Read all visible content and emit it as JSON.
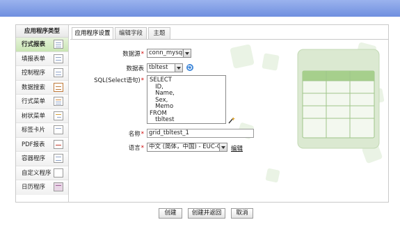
{
  "sidebar": {
    "title": "应用程序类型",
    "items": [
      {
        "label": "行式报表",
        "icon": "grid-report-icon"
      },
      {
        "label": "填报表单",
        "icon": "form-icon"
      },
      {
        "label": "控制程序",
        "icon": "control-program-icon"
      },
      {
        "label": "数据搜索",
        "icon": "search-data-icon"
      },
      {
        "label": "行式菜单",
        "icon": "row-menu-icon"
      },
      {
        "label": "树状菜单",
        "icon": "tree-menu-icon"
      },
      {
        "label": "标签卡片",
        "icon": "tab-card-icon"
      },
      {
        "label": "PDF报表",
        "icon": "pdf-report-icon"
      },
      {
        "label": "容器程序",
        "icon": "container-icon"
      },
      {
        "label": "自定义程序",
        "icon": "custom-program-icon"
      },
      {
        "label": "日历程序",
        "icon": "calendar-icon"
      }
    ]
  },
  "tabs": [
    {
      "label": "应用程序设置"
    },
    {
      "label": "编辑字段"
    },
    {
      "label": "主题"
    }
  ],
  "form": {
    "datasource_label": "数据源",
    "datasource_value": "conn_mysql",
    "datatable_label": "数据表",
    "datatable_value": "tbltest",
    "sql_label": "SQL(Select语句)",
    "sql_value": "SELECT\n   ID,\n   Name,\n   Sex,\n   Memo\nFROM\n   tbltest",
    "name_label": "名称",
    "name_value": "grid_tbltest_1",
    "language_label": "语言",
    "language_value": "中文 (简体，中国) - EUC-CN",
    "edit_link": "编辑",
    "required_mark": "*"
  },
  "buttons": {
    "create": "创建",
    "create_and_return": "创建并返回",
    "cancel": "取消"
  }
}
